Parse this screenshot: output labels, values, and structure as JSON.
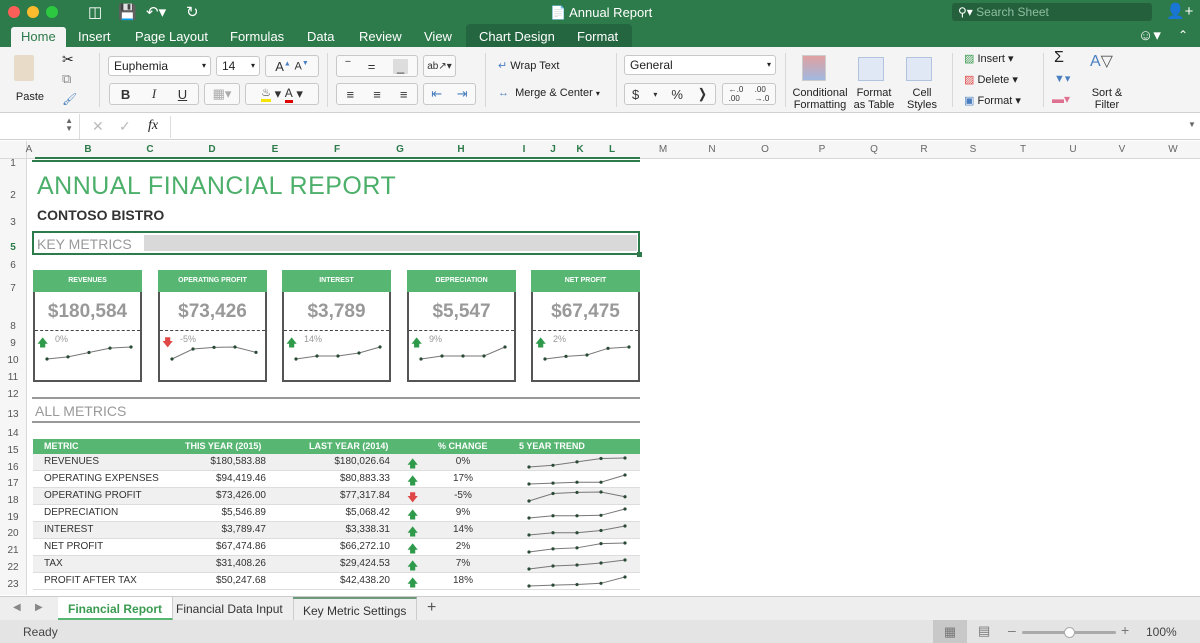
{
  "window": {
    "title": "Annual Report",
    "search_placeholder": "Search Sheet"
  },
  "ribbon_tabs": [
    {
      "label": "Home",
      "active": true
    },
    {
      "label": "Insert"
    },
    {
      "label": "Page Layout"
    },
    {
      "label": "Formulas"
    },
    {
      "label": "Data"
    },
    {
      "label": "Review"
    },
    {
      "label": "View"
    },
    {
      "label": "Chart Design"
    },
    {
      "label": "Format"
    }
  ],
  "ribbon": {
    "paste": "Paste",
    "font": "Euphemia",
    "font_size": "14",
    "bold": "B",
    "italic": "I",
    "underline": "U",
    "wrap_text": "Wrap Text",
    "merge_center": "Merge & Center",
    "number_format": "General",
    "currency": "$",
    "percent": "%",
    "comma": "❭",
    "conditional_formatting": [
      "Conditional",
      "Formatting"
    ],
    "format_as_table": [
      "Format",
      "as Table"
    ],
    "cell_styles": [
      "Cell",
      "Styles"
    ],
    "insert": "Insert",
    "delete": "Delete",
    "format": "Format",
    "sort_filter": [
      "Sort &",
      "Filter"
    ],
    "sum": "Σ"
  },
  "formula_bar": {
    "name_box": "",
    "formula": "",
    "fx": "fx"
  },
  "columns": [
    "A",
    "B",
    "C",
    "D",
    "E",
    "F",
    "G",
    "H",
    "I",
    "J",
    "K",
    "L",
    "M",
    "N",
    "O",
    "P",
    "Q",
    "R",
    "S",
    "T",
    "U",
    "V",
    "W"
  ],
  "rows": [
    "1",
    "2",
    "3",
    "5",
    "6",
    "7",
    "8",
    "9",
    "10",
    "11",
    "12",
    "13",
    "14",
    "15",
    "16",
    "17",
    "18",
    "19",
    "20",
    "21",
    "22",
    "23"
  ],
  "report": {
    "title": "ANNUAL FINANCIAL REPORT",
    "company": "CONTOSO BISTRO",
    "key_metrics_label": "KEY METRICS",
    "all_metrics_label": "ALL METRICS"
  },
  "cards": [
    {
      "label": "REVENUES",
      "value": "$180,584",
      "change": "0%",
      "direction": "up",
      "trend": [
        1,
        2,
        4,
        6,
        6.5
      ]
    },
    {
      "label": "OPERATING PROFIT",
      "value": "$73,426",
      "change": "-5%",
      "direction": "down",
      "trend": [
        1,
        4,
        4.5,
        4.6,
        3
      ]
    },
    {
      "label": "INTEREST",
      "value": "$3,789",
      "change": "14%",
      "direction": "up",
      "trend": [
        1,
        2,
        2,
        3,
        5
      ]
    },
    {
      "label": "DEPRECIATION",
      "value": "$5,547",
      "change": "9%",
      "direction": "up",
      "trend": [
        1,
        2,
        2,
        2,
        5
      ]
    },
    {
      "label": "NET PROFIT",
      "value": "$67,475",
      "change": "2%",
      "direction": "up",
      "trend": [
        1,
        2,
        2.5,
        5,
        5.5
      ]
    }
  ],
  "table": {
    "headers": [
      "METRIC",
      "THIS YEAR (2015)",
      "LAST YEAR (2014)",
      "% CHANGE",
      "5 YEAR TREND"
    ],
    "rows": [
      {
        "metric": "REVENUES",
        "this_year": "$180,583.88",
        "last_year": "$180,026.64",
        "direction": "up",
        "change": "0%",
        "trend": [
          1,
          2,
          4,
          6,
          6.3
        ]
      },
      {
        "metric": "OPERATING EXPENSES",
        "this_year": "$94,419.46",
        "last_year": "$80,883.33",
        "direction": "up",
        "change": "17%",
        "trend": [
          1,
          1.5,
          2,
          2,
          6
        ]
      },
      {
        "metric": "OPERATING PROFIT",
        "this_year": "$73,426.00",
        "last_year": "$77,317.84",
        "direction": "down",
        "change": "-5%",
        "trend": [
          1,
          4.5,
          5,
          5.2,
          3
        ]
      },
      {
        "metric": "DEPRECIATION",
        "this_year": "$5,546.89",
        "last_year": "$5,068.42",
        "direction": "up",
        "change": "9%",
        "trend": [
          1,
          2,
          2,
          2.2,
          5
        ]
      },
      {
        "metric": "INTEREST",
        "this_year": "$3,789.47",
        "last_year": "$3,338.31",
        "direction": "up",
        "change": "14%",
        "trend": [
          1,
          2,
          2,
          3,
          5
        ]
      },
      {
        "metric": "NET PROFIT",
        "this_year": "$67,474.86",
        "last_year": "$66,272.10",
        "direction": "up",
        "change": "2%",
        "trend": [
          1,
          2.5,
          3,
          5,
          5.3
        ]
      },
      {
        "metric": "TAX",
        "this_year": "$31,408.26",
        "last_year": "$29,424.53",
        "direction": "up",
        "change": "7%",
        "trend": [
          1,
          2.5,
          3,
          4,
          5.5
        ]
      },
      {
        "metric": "PROFIT AFTER TAX",
        "this_year": "$50,247.68",
        "last_year": "$42,438.20",
        "direction": "up",
        "change": "18%",
        "trend": [
          1,
          1.5,
          1.8,
          2.5,
          6
        ]
      }
    ]
  },
  "sheet_tabs": [
    {
      "label": "Financial Report",
      "active": true
    },
    {
      "label": "Financial Data Input"
    },
    {
      "label": "Key Metric Settings"
    }
  ],
  "status": {
    "text": "Ready",
    "zoom": "100%",
    "zoom_level": 0.5
  },
  "colors": {
    "accent": "#2d7a4a",
    "header_green": "#57b672",
    "title_green": "#4caf6a",
    "up": "#2e9a4a",
    "down": "#e04848"
  }
}
